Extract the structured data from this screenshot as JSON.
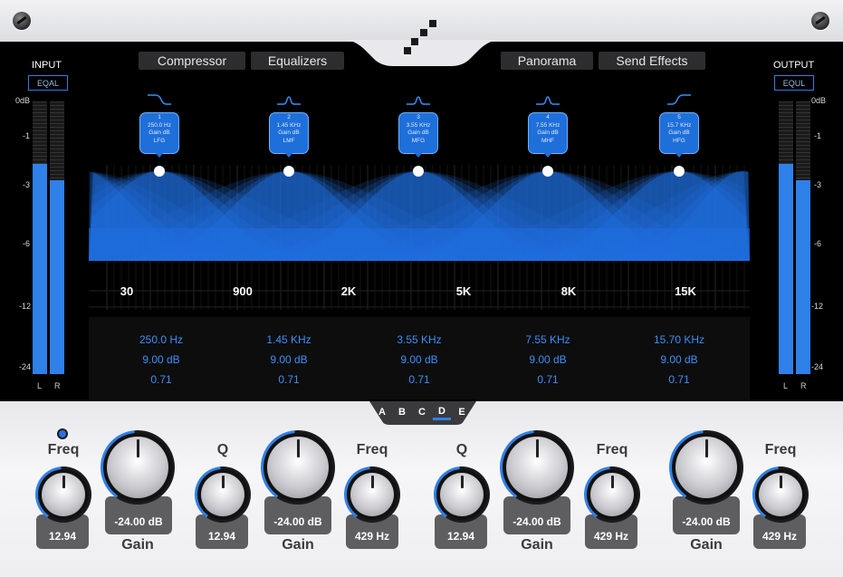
{
  "tabs": {
    "compressor": "Compressor",
    "equalizers": "Equalizers",
    "panorama": "Panorama",
    "send_effects": "Send Effects"
  },
  "input_meter": {
    "title": "INPUT",
    "mode": "EQAL",
    "scale": [
      "0dB",
      "-1",
      "-3",
      "-6",
      "-12",
      "-24"
    ],
    "channels": [
      "L",
      "R"
    ],
    "levels": [
      0.77,
      0.71
    ]
  },
  "output_meter": {
    "title": "OUTPUT",
    "mode": "EQUL",
    "scale": [
      "0dB",
      "-1",
      "-3",
      "-6",
      "-12",
      "-24"
    ],
    "channels": [
      "L",
      "R"
    ],
    "levels": [
      0.77,
      0.71
    ]
  },
  "freq_axis": [
    "30",
    "900",
    "2K",
    "5K",
    "8K",
    "15K"
  ],
  "bands": [
    {
      "num": "1",
      "freq": "250.0 Hz",
      "gain": "Gain dB",
      "name": "LFG",
      "shape": "lowshelf"
    },
    {
      "num": "2",
      "freq": "1.45 KHz",
      "gain": "Gain dB",
      "name": "LMF",
      "shape": "bell"
    },
    {
      "num": "3",
      "freq": "3.55 KHz",
      "gain": "Gain dB",
      "name": "MFG",
      "shape": "bell"
    },
    {
      "num": "4",
      "freq": "7.55 KHz",
      "gain": "Gain dB",
      "name": "MHF",
      "shape": "bell"
    },
    {
      "num": "5",
      "freq": "15.7 KHz",
      "gain": "Gain dB",
      "name": "HFG",
      "shape": "highshelf"
    }
  ],
  "band_values": [
    {
      "freq": "250.0 Hz",
      "gain": "9.00 dB",
      "q": "0.71"
    },
    {
      "freq": "1.45 KHz",
      "gain": "9.00 dB",
      "q": "0.71"
    },
    {
      "freq": "3.55 KHz",
      "gain": "9.00 dB",
      "q": "0.71"
    },
    {
      "freq": "7.55 KHz",
      "gain": "9.00 dB",
      "q": "0.71"
    },
    {
      "freq": "15.70 KHz",
      "gain": "9.00 dB",
      "q": "0.71"
    }
  ],
  "band_selector": {
    "items": [
      "A",
      "B",
      "C",
      "D",
      "E"
    ],
    "active": "D"
  },
  "knobs": {
    "k1": {
      "label": "Freq",
      "value": "12.94"
    },
    "k2": {
      "label": "Gain",
      "value": "-24.00 dB"
    },
    "k3": {
      "label": "Q",
      "value": "12.94"
    },
    "k4": {
      "label": "Gain",
      "value": "-24.00 dB"
    },
    "k5": {
      "label": "Freq",
      "value": "429 Hz"
    },
    "k6": {
      "label": "Q",
      "value": "12.94"
    },
    "k7": {
      "label": "Gain",
      "value": "-24.00 dB"
    },
    "k8": {
      "label": "Freq",
      "value": "429 Hz"
    },
    "k9": {
      "label": "Gain",
      "value": "-24.00 dB"
    },
    "k10": {
      "label": "Freq",
      "value": "429 Hz"
    }
  },
  "colors": {
    "accent": "#2f80e8",
    "curve": "#1f6ee0",
    "panel": "#000000"
  }
}
